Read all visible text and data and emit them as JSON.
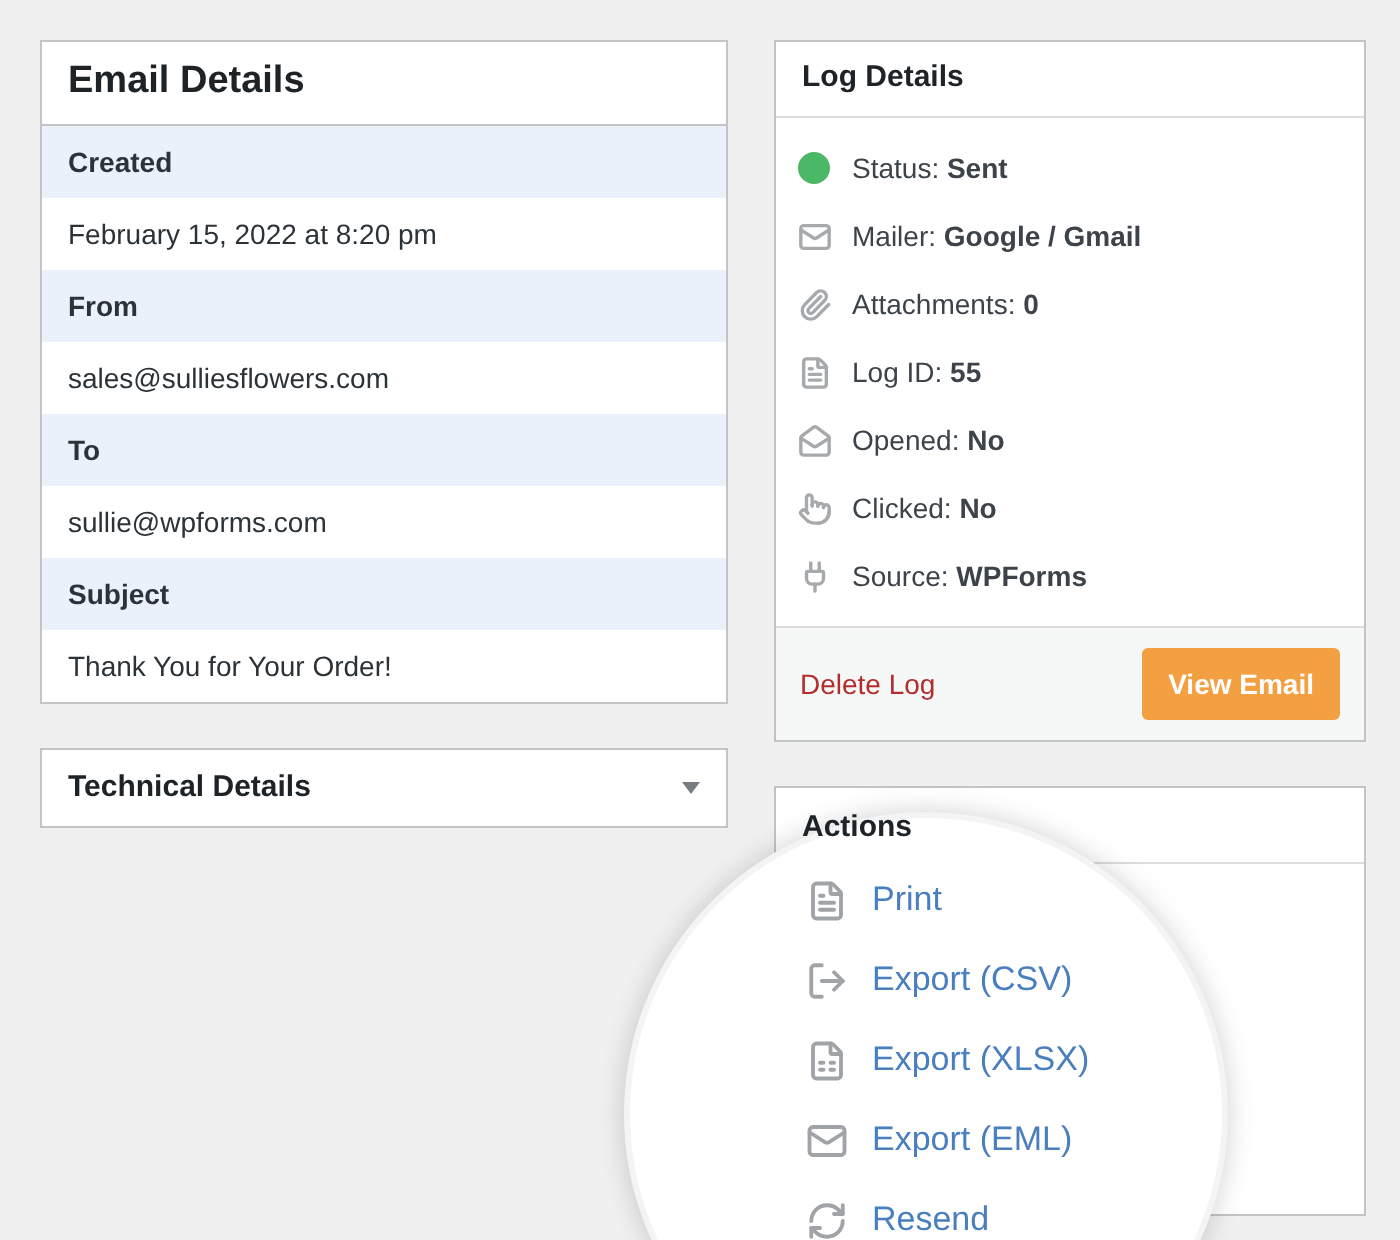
{
  "email_details": {
    "title": "Email Details",
    "fields": [
      {
        "label": "Created",
        "value": "February 15, 2022 at 8:20 pm"
      },
      {
        "label": "From",
        "value": "sales@sulliesflowers.com"
      },
      {
        "label": "To",
        "value": "sullie@wpforms.com"
      },
      {
        "label": "Subject",
        "value": "Thank You for Your Order!"
      }
    ]
  },
  "technical_details": {
    "title": "Technical Details",
    "expanded": false
  },
  "log_details": {
    "title": "Log Details",
    "items": [
      {
        "kind": "status",
        "text": "Status: **Sent**",
        "color": "#4ab866"
      },
      {
        "kind": "mailer",
        "text": "Mailer: **Google / Gmail**"
      },
      {
        "kind": "attachments",
        "text": "Attachments: **0**"
      },
      {
        "kind": "log_id",
        "text": "Log ID: **55**"
      },
      {
        "kind": "opened",
        "text": "Opened: **No**"
      },
      {
        "kind": "clicked",
        "text": "Clicked: **No**"
      },
      {
        "kind": "source",
        "text": "Source: **WPForms**"
      }
    ],
    "delete_link": "Delete Log",
    "view_button": "View Email"
  },
  "actions": {
    "title": "Actions",
    "items": [
      {
        "kind": "print",
        "label": "Print"
      },
      {
        "kind": "export",
        "label": "Export (CSV)"
      },
      {
        "kind": "spreadsheet",
        "label": "Export (XLSX)"
      },
      {
        "kind": "mail",
        "label": "Export (EML)"
      },
      {
        "kind": "resend",
        "label": "Resend"
      }
    ]
  }
}
